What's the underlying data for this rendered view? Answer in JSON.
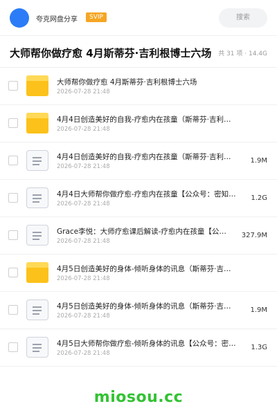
{
  "header": {
    "user_name": "夸克网盘分享",
    "badge": "SVIP",
    "search_label": "搜索"
  },
  "share": {
    "title": "大师帮你做疗愈 4月斯蒂芬·吉利根博士六场",
    "meta": "共 31 项 · 14.4G"
  },
  "files": [
    {
      "type": "folder",
      "name": "大师帮你做疗愈 4月斯蒂芬·吉利根博士六场",
      "date": "2026-07-28 21:48",
      "size": ""
    },
    {
      "type": "folder",
      "name": "4月4日创造美好的自我-疗愈内在孩童（斯蒂芬·吉利…",
      "date": "2026-07-28 21:48",
      "size": ""
    },
    {
      "type": "doc",
      "name": "4月4日创造美好的自我-疗愈内在孩童（斯蒂芬·吉利…",
      "date": "2026-07-28 21:48",
      "size": "1.9M"
    },
    {
      "type": "doc",
      "name": "4月4日大师帮你做疗愈-疗愈内在孩童【公众号：密知…",
      "date": "2026-07-28 21:48",
      "size": "1.2G"
    },
    {
      "type": "doc",
      "name": "Grace李悦：大师疗愈课后解读-疗愈内在孩童【公…",
      "date": "2026-07-28 21:48",
      "size": "327.9M"
    },
    {
      "type": "folder",
      "name": "4月5日创造美好的身体-倾听身体的讯息（斯蒂芬·吉…",
      "date": "2026-07-28 21:48",
      "size": ""
    },
    {
      "type": "doc",
      "name": "4月5日创造美好的身体-倾听身体的讯息（斯蒂芬·吉…",
      "date": "2026-07-28 21:48",
      "size": "1.9M"
    },
    {
      "type": "doc",
      "name": "4月5日大师帮你做疗愈-倾听身体的讯息【公众号：密…",
      "date": "2026-07-28 21:48",
      "size": "1.3G"
    }
  ],
  "watermark": "miosou.cc",
  "colors": {
    "avatar": "#2b7cf6",
    "svip_badge": "#f5a623",
    "folder": "#fcc21b",
    "watermark": "#33c233"
  },
  "icons": {
    "folder": "folder-icon",
    "doc": "document-icon"
  }
}
